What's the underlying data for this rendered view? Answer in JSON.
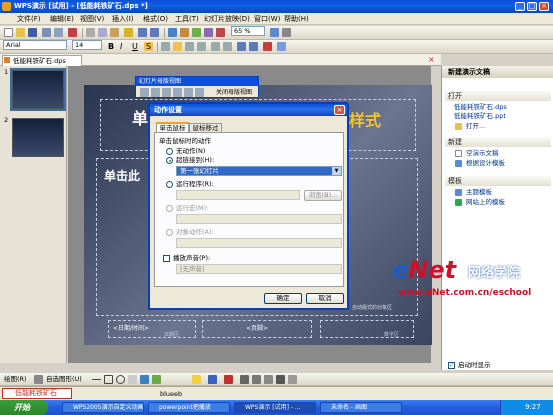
{
  "window": {
    "title": "WPS演示 [试用] - [低能耗铁矿石.dps *]"
  },
  "menu": [
    "文件(F)",
    "编辑(E)",
    "视图(V)",
    "插入(I)",
    "格式(O)",
    "工具(T)",
    "幻灯片放映(D)",
    "窗口(W)",
    "帮助(H)"
  ],
  "toolbar": {
    "zoom": "65 %",
    "font": "Arial",
    "size": "14"
  },
  "doc_tab": "低能耗铁矿石.dps",
  "thumbs": [
    "1",
    "2"
  ],
  "float_toolbar": {
    "title": "幻灯片母版视图",
    "close_label": "关闭母版视图"
  },
  "slide": {
    "title_left": "单",
    "title_right": "样式",
    "body_text": "单击此",
    "footer_date": "<日期/时间>",
    "footer_text": "<页脚>",
    "number_area": "数字区",
    "hint_right": "自动版式的对象区",
    "date_area": "日期区"
  },
  "dialog": {
    "title": "动作设置",
    "tabs": [
      "单击鼠标",
      "鼠标移过"
    ],
    "group_label": "单击鼠标时的动作",
    "opt_none": "无动作(N)",
    "opt_link": "超链接到(H):",
    "link_value": "第一张幻灯片",
    "opt_run": "运行程序(R):",
    "browse": "浏览(B)...",
    "opt_macro": "运行宏(M):",
    "opt_obj": "对象动作(A):",
    "sound_check": "播放声音(P):",
    "sound_value": "[无声音]",
    "ok": "确定",
    "cancel": "取消"
  },
  "taskpane": {
    "title": "新建演示文稿",
    "sec_open": "打开",
    "recent": [
      "低能耗铁矿石.dps",
      "低能耗铁矿石.ppt"
    ],
    "open_more": "打开...",
    "sec_new": "新建",
    "new_items": [
      "空演示文稿",
      "根据设计模板"
    ],
    "sec_tpl": "模板",
    "tpl_items": [
      "主题模板",
      "网站上的模板"
    ],
    "show_startup": "启动时显示"
  },
  "watermark": {
    "brand_e": "e",
    "brand_net": "Net",
    "brand_cn": "网络学院",
    "url": "www.eNet.com.cn/eschool"
  },
  "drawbar": {
    "draw": "绘图(R)",
    "autoshape": "自选图形(U)"
  },
  "status": {
    "tabs": [
      "低能耗铁矿石"
    ],
    "text": "blueeb"
  },
  "taskbar": {
    "start": "开始",
    "items": [
      "WPS2005演示自定义动画",
      "powerpoint把播放",
      "WPS演示 [试用] - ...",
      "未命名 - 画图"
    ],
    "clock": "9:27"
  },
  "colors": {
    "titlebar": "#0a4fd6",
    "slide_bg": "#3a4560",
    "link_blue": "#00348c",
    "watermark_red": "#d0102a"
  }
}
